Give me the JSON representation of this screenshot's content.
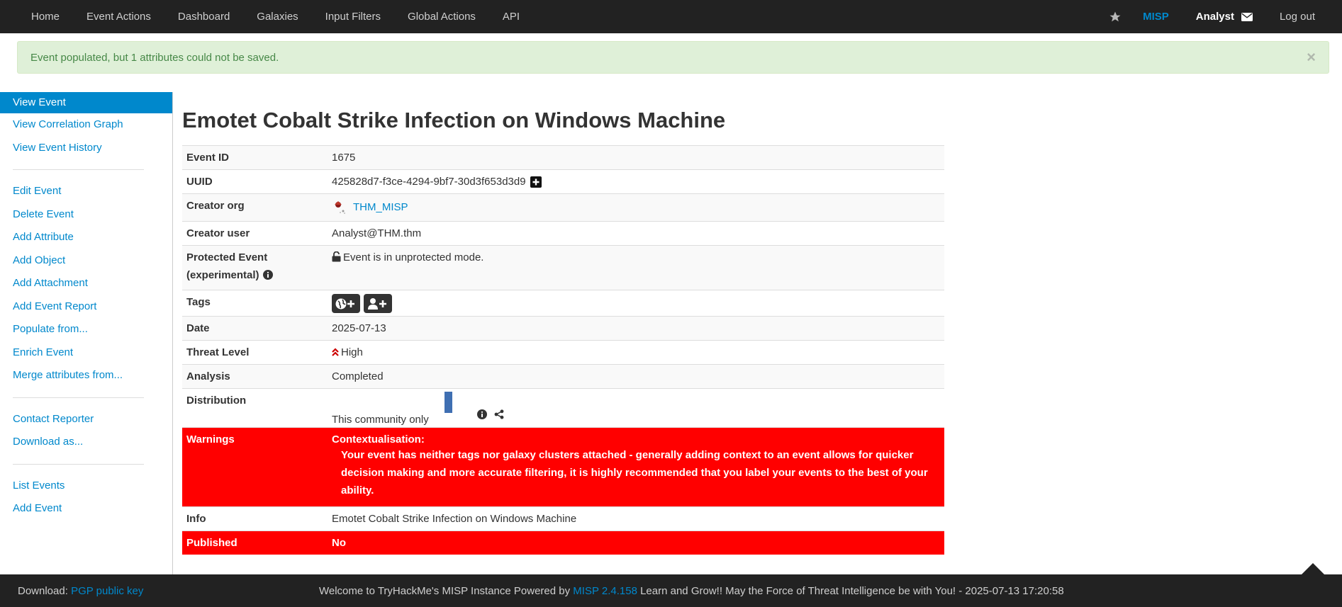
{
  "navbar": {
    "items": [
      "Home",
      "Event Actions",
      "Dashboard",
      "Galaxies",
      "Input Filters",
      "Global Actions",
      "API"
    ],
    "brand": "MISP",
    "user": "Analyst",
    "logout": "Log out"
  },
  "alert": {
    "message": "Event populated, but 1 attributes could not be saved.",
    "close": "×"
  },
  "sidebar": {
    "group1": [
      "View Event",
      "View Correlation Graph",
      "View Event History"
    ],
    "group2": [
      "Edit Event",
      "Delete Event",
      "Add Attribute",
      "Add Object",
      "Add Attachment",
      "Add Event Report",
      "Populate from...",
      "Enrich Event",
      "Merge attributes from..."
    ],
    "group3": [
      "Contact Reporter",
      "Download as..."
    ],
    "group4": [
      "List Events",
      "Add Event"
    ]
  },
  "event": {
    "title": "Emotet Cobalt Strike Infection on Windows Machine",
    "labels": {
      "event_id": "Event ID",
      "uuid": "UUID",
      "creator_org": "Creator org",
      "creator_user": "Creator user",
      "protected_line1": "Protected Event",
      "protected_line2": "(experimental)",
      "tags": "Tags",
      "date": "Date",
      "threat_level": "Threat Level",
      "analysis": "Analysis",
      "distribution": "Distribution",
      "warnings": "Warnings",
      "info": "Info",
      "published": "Published"
    },
    "event_id": "1675",
    "uuid": "425828d7-f3ce-4294-9bf7-30d3f653d3d9",
    "creator_org": "THM_MISP",
    "creator_user": "Analyst@THM.thm",
    "protected": "Event is in unprotected mode.",
    "date": "2025-07-13",
    "threat_level": "High",
    "analysis": "Completed",
    "distribution": "This community only",
    "warning_title": "Contextualisation:",
    "warning_text": "Your event has neither tags nor galaxy clusters attached - generally adding context to an event allows for quicker decision making and more accurate filtering, it is highly recommended that you label your events to the best of your ability.",
    "info": "Emotet Cobalt Strike Infection on Windows Machine",
    "published": "No"
  },
  "footer": {
    "download_prefix": "Download:",
    "download_link": "PGP public key",
    "welcome_prefix": "Welcome to TryHackMe's MISP Instance Powered by",
    "version": "MISP 2.4.158",
    "welcome_suffix": "Learn and Grow!! May the Force of Threat Intelligence be with You! - 2025-07-13 17:20:58"
  },
  "colors": {
    "navbar": "#222222",
    "link": "#0088cc",
    "warning": "#ff0000",
    "alert_bg": "#dff0d8",
    "alert_text": "#468847",
    "distribution_bar": "#3f6fb2"
  }
}
